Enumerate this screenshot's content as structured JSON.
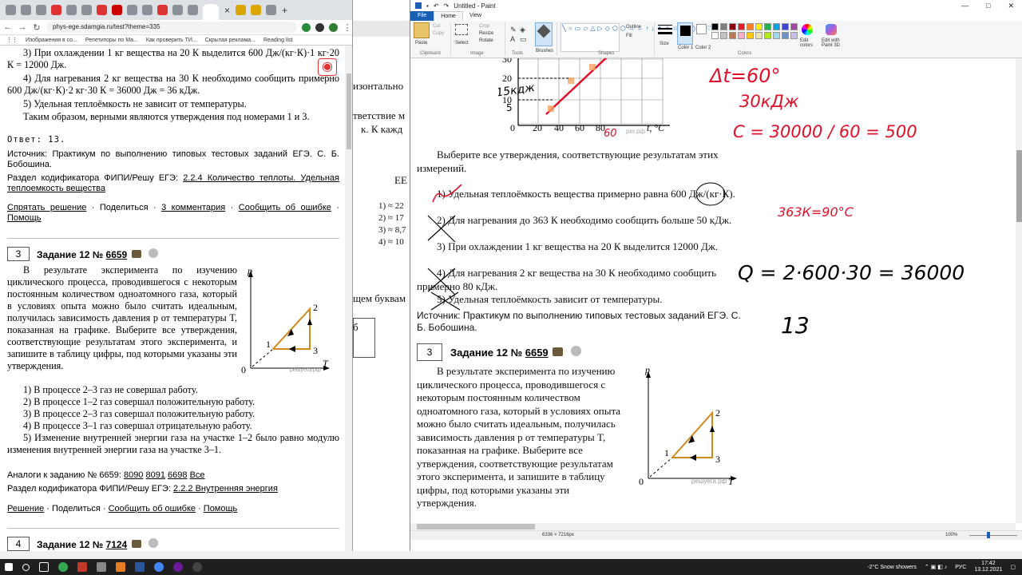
{
  "browser": {
    "url": "phys-ege.sdamgia.ru/test?theme=335",
    "close_tab": "×",
    "new_tab": "+",
    "bookmarks": [
      "Изображения в со...",
      "Репетиторы по Ма...",
      "Как проверить ТИ...",
      "Скрытая реклама...",
      "Reading list"
    ],
    "content": {
      "line3": "3)  При  охлаждении  1  кг  вещества  на  20  К  выделится 600 Дж/(кг·К)·1 кг·20 К = 12000 Дж.",
      "line4": "4)  Для нагревания 2 кг вещества на 30 К необходимо сообщить примерно 600 Дж/(кг·К)·2 кг·30 К = 36000 Дж = 36 кДж.",
      "line5": "5) Удельная теплоёмкость не зависит от температуры.",
      "conclusion": "Таким образом, верными являются утверждения под номерами 1 и 3.",
      "answer": "Ответ: 13.",
      "source": "Источник: Практикум по выполнению типовых тестовых заданий ЕГЭ. С. Б. Бобошина.",
      "section_prefix": "Раздел кодификатора ФИПИ/Решу ЕГЭ:",
      "section_link": "2.2.4 Количество теплоты. Удельная теплоемкость вещества",
      "actions1": [
        "Спрятать решение",
        "Поделиться",
        "3 комментария",
        "Сообщить об ошибке",
        "Помощь"
      ],
      "task3_num": "3",
      "task3_title": "Задание 12 №",
      "task3_id": "6659",
      "task3_text": "В результате эксперимента по изучению циклического процесса, проводившегося с некоторым постоянным количеством одноатомного газа, который в условиях опыта можно было считать идеальным, получилась зависимость давления p от температуры T, показанная на графике. Выберите все утверждения, соответствующие результатам этого эксперимента, и запишите в таблицу цифры, под которыми указаны эти утверждения.",
      "opt1": "1) В процессе 2–3 газ не совершал работу.",
      "opt2": "2) В процессе 1–2 газ совершал положительную работу.",
      "opt3": "3) В процессе 2–3 газ совершал положительную работу.",
      "opt4": "4) В процессе 3–1 газ совершал отрицательную работу.",
      "opt5": "5) Изменение внутренней энергии газа на участке 1–2 было равно модулю изменения внутренней энергии газа на участке 3–1.",
      "analogs_prefix": "Аналоги к заданию № 6659:",
      "analogs": [
        "8090",
        "8091",
        "6698",
        "Все"
      ],
      "section2_prefix": "Раздел кодификатора ФИПИ/Решу ЕГЭ:",
      "section2_link": "2.2.2 Внутренняя энергия",
      "actions2": [
        "Решение",
        "Поделиться",
        "Сообщить об ошибке",
        "Помощь"
      ],
      "task4_num": "4",
      "task4_title": "Задание 12 №",
      "task4_id": "7124",
      "graph_labels": {
        "p": "p",
        "T": "T",
        "zero": "0",
        "n1": "1",
        "n2": "2",
        "n3": "3",
        "wm": "решуега.рф"
      }
    }
  },
  "bgdoc": {
    "frag1": "изонтально",
    "frag2": "тветствие м",
    "frag3": "к. К кажд",
    "frag4": "ЕЕ",
    "items": [
      "1) ≈ 22",
      "2) ≈ 17",
      "3) ≈ 8,7",
      "4) ≈ 10"
    ],
    "frag5": "щем буквам",
    "frag6": "б"
  },
  "paint": {
    "title": "Untitled - Paint",
    "menu": {
      "file": "File",
      "home": "Home",
      "view": "View"
    },
    "ribbon": {
      "paste": "Paste",
      "cut": "Cut",
      "copy": "Copy",
      "select": "Select",
      "crop": "Crop",
      "resize": "Resize",
      "rotate": "Rotate",
      "brushes": "Brushes",
      "size": "Size",
      "color1": "Color 1",
      "color2": "Color 2",
      "edit_colors": "Edit colors",
      "paint3d": "Edit with Paint 3D",
      "outline": "Outline",
      "fill": "Fill",
      "groups": [
        "Clipboard",
        "Image",
        "Tools",
        "Shapes",
        "Colors"
      ]
    },
    "palette": [
      "#000000",
      "#7f7f7f",
      "#880015",
      "#ed1c24",
      "#ff7f27",
      "#fff200",
      "#22b14c",
      "#00a2e8",
      "#3f48cc",
      "#a349a4",
      "#ffffff",
      "#c3c3c3",
      "#b97a57",
      "#ffaec9",
      "#ffc90e",
      "#efe4b0",
      "#b5e61d",
      "#99d9ea",
      "#7092be",
      "#c8bfe7"
    ],
    "canvas": {
      "graph_ticks": [
        "30",
        "20",
        "10",
        "0",
        "20",
        "40",
        "60",
        "80"
      ],
      "graph_xlabel": "t, °C",
      "wm": "рег.рф",
      "intro": "Выберите все утверждения, соответствующие результатам этих измерений.",
      "s1": "1) Удельная теплоёмкость вещества примерно равна 600 Дж/(кг·К).",
      "s2": "2) Для нагревания до 363 К необходимо сообщить больше 50 кДж.",
      "s3": "3) При охлаждении 1 кг вещества на 20 К выделится 12000 Дж.",
      "s4": "4) Для нагревания 2 кг вещества на 30 К необходимо сообщить примерно 80 кДж.",
      "s5": "5) Удельная теплоёмкость зависит от температуры.",
      "source": "Источник: Практикум по выполнению типовых тестовых заданий ЕГЭ. С. Б. Бобошина.",
      "task_num": "3",
      "task_title": "Задание 12 №",
      "task_id": "6659",
      "task_text": "В результате эксперимента по изучению циклического процесса, проводившегося с некоторым постоянным количеством одноатомного газа, который в условиях опыта можно было считать идеальным, получилась зависимость давления p от температуры T, показанная на графике. Выберите все утверждения, соответствующие результатам этого эксперимента, и запишите в таблицу цифры, под которыми указаны эти утверждения.",
      "handwriting": {
        "dt": "Δt=60°",
        "kj": "30кДж",
        "c_formula": "C = 30000 / 60 = 500",
        "temp": "363К=90°С",
        "q_formula": "Q = 2·600·30 = 36000",
        "answer": "13",
        "left_note": "15кдж",
        "five": "5",
        "sixty": "60"
      }
    },
    "status": {
      "size": "6336 × 7216px",
      "zoom": "100%"
    }
  },
  "taskbar": {
    "weather": "-2°C  Snow showers",
    "lang": "РУС",
    "time": "17:42",
    "date": "13.12.2021"
  }
}
